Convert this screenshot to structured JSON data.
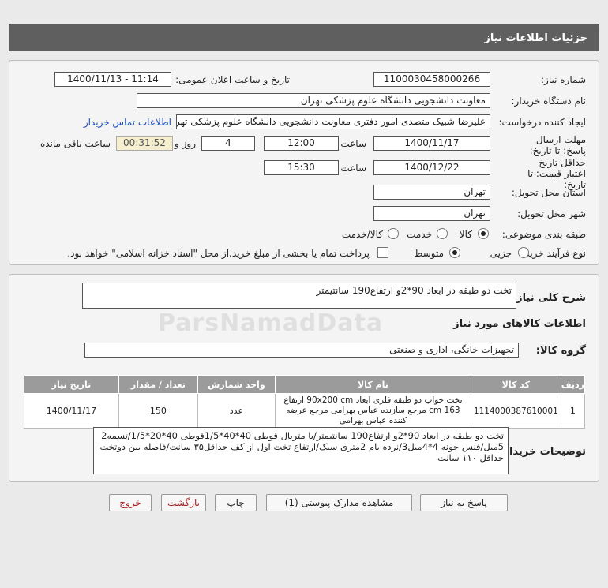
{
  "page": {
    "title": "جزئيات اطلاعات نياز"
  },
  "info": {
    "need_number_label": "شماره نیاز:",
    "need_number": "1100030458000266",
    "announce_label": "تاریخ و ساعت اعلان عمومی:",
    "announce_value": "1400/11/13 - 11:14",
    "buyer_org_label": "نام دستگاه خریدار:",
    "buyer_org": "معاونت دانشجویی دانشگاه علوم پزشکی تهران",
    "creator_label": "ایجاد کننده درخواست:",
    "creator": "علیرضا شبیک متصدی امور دفتری معاونت دانشجویی دانشگاه علوم پزشکی تهران",
    "contact_link": "اطلاعات تماس خریدار",
    "deadline_label": "مهلت ارسال پاسخ: تا تاریخ:",
    "deadline_date": "1400/11/17",
    "time_label": "ساعت",
    "deadline_time": "12:00",
    "days_value": "4",
    "days_label": "روز و",
    "remaining_time": "00:31:52",
    "remaining_label": "ساعت باقی مانده",
    "validity_label": "حداقل تاریخ اعتبار قیمت: تا تاریخ:",
    "validity_date": "1400/12/22",
    "validity_time": "15:30",
    "province_label": "استان محل تحویل:",
    "province": "تهران",
    "city_label": "شهر محل تحویل:",
    "city": "تهران",
    "category_label": "طبقه بندی موضوعی:",
    "category_options": [
      "کالا",
      "خدمت",
      "کالا/خدمت"
    ],
    "category_selected": "کالا",
    "process_label": "نوع فرآیند خرید :",
    "process_options": [
      "جزیی",
      "متوسط"
    ],
    "process_selected": "متوسط",
    "payment_note": "پرداخت تمام یا بخشی از مبلغ خرید،از محل \"اسناد خزانه اسلامی\" خواهد بود."
  },
  "summary": {
    "label": "شرح کلی نیاز:",
    "value": "تخت دو طبقه در ابعاد 90*2و ارتفاع190 سانتیمتر"
  },
  "goods": {
    "section_title": "اطلاعات کالاهای مورد نیاز",
    "group_label": "گروه کالا:",
    "group_value": "تجهیزات خانگی، اداری و صنعتی",
    "columns": [
      "ردیف",
      "کد کالا",
      "نام کالا",
      "واحد شمارش",
      "تعداد / مقدار",
      "تاریخ نیاز"
    ],
    "rows": [
      {
        "index": "1",
        "code": "1114000387610001",
        "name": "تخت خواب دو طبقه فلزی ابعاد 90x200 cm ارتفاع 163 cm مرجع سازنده عباس بهرامی مرجع عرضه کننده عباس بهرامی",
        "unit": "عدد",
        "qty": "150",
        "date": "1400/11/17"
      }
    ]
  },
  "buyer_notes": {
    "label": "توضیحات خریدار:",
    "value": "تخت دو طبقه در ابعاد 90*2و ارتفاع190 سانتیمتر/با متریال قوطی 40*40*1/5قوطی 40*20*1/5/تسمه2 5میل/فنس خونه 4*4میل3/نرده بام 2متری سبک/ارتفاع تخت اول از کف حداقل۳۵ سانت/فاصله بین دوتخت حداقل ۱۱۰ سانت"
  },
  "buttons": {
    "reply": "پاسخ به نیاز",
    "attachments": "مشاهده مدارک پیوستی (1)",
    "print": "چاپ",
    "back": "بازگشت",
    "exit": "خروج"
  },
  "watermark": "ParsNamadData"
}
